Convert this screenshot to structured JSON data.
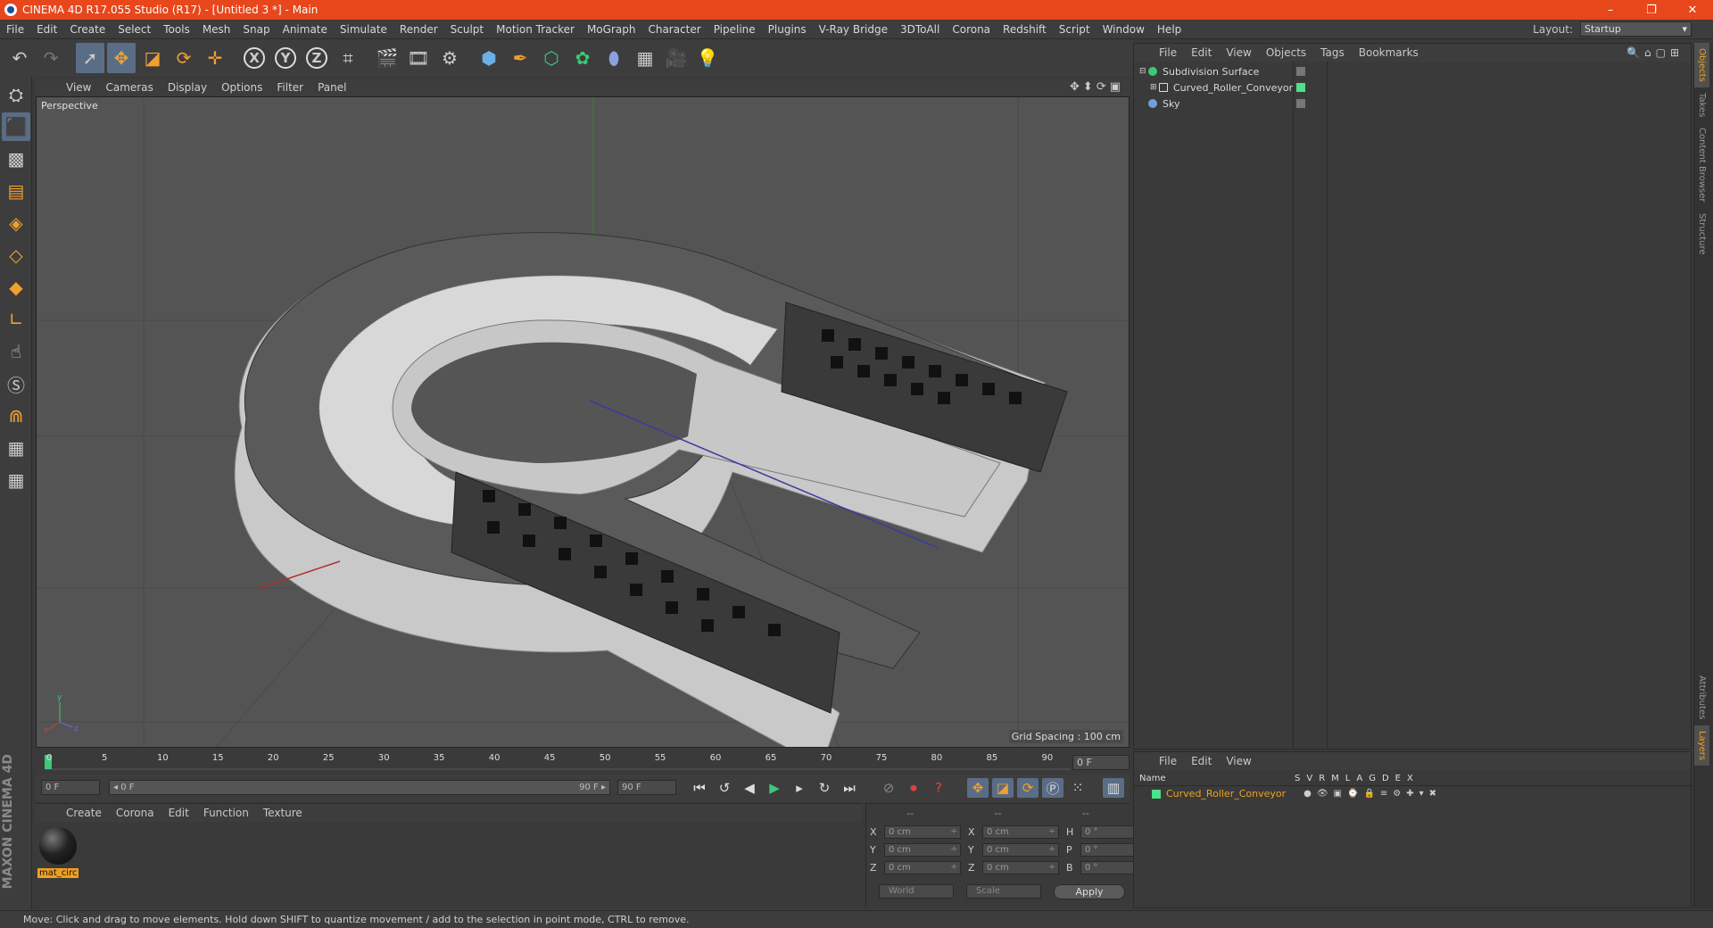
{
  "window": {
    "title": "CINEMA 4D R17.055 Studio (R17) - [Untitled 3 *] - Main",
    "min": "–",
    "max": "❐",
    "close": "✕"
  },
  "menu": [
    "File",
    "Edit",
    "Create",
    "Select",
    "Tools",
    "Mesh",
    "Snap",
    "Animate",
    "Simulate",
    "Render",
    "Sculpt",
    "Motion Tracker",
    "MoGraph",
    "Character",
    "Pipeline",
    "Plugins",
    "V-Ray Bridge",
    "3DToAll",
    "Corona",
    "Redshift",
    "Script",
    "Window",
    "Help"
  ],
  "layout": {
    "label": "Layout:",
    "value": "Startup"
  },
  "viewport": {
    "menu": [
      "View",
      "Cameras",
      "Display",
      "Options",
      "Filter",
      "Panel"
    ],
    "camera_label": "Perspective",
    "grid_spacing": "Grid Spacing : 100 cm"
  },
  "timeline": {
    "ticks": [
      "0",
      "5",
      "10",
      "15",
      "20",
      "25",
      "30",
      "35",
      "40",
      "45",
      "50",
      "55",
      "60",
      "65",
      "70",
      "75",
      "80",
      "85",
      "90"
    ],
    "current_frame": "0 F",
    "start_field": "0 F",
    "range_left": "◂ 0 F",
    "range_right": "90 F ▸",
    "end_field": "90 F"
  },
  "material_panel": {
    "menu": [
      "Create",
      "Corona",
      "Edit",
      "Function",
      "Texture"
    ],
    "material_name": "mat_circ"
  },
  "coords": {
    "headers": [
      "--",
      "--",
      "--"
    ],
    "rows": [
      {
        "a": "X",
        "av": "0 cm",
        "b": "X",
        "bv": "0 cm",
        "c": "H",
        "cv": "0 °"
      },
      {
        "a": "Y",
        "av": "0 cm",
        "b": "Y",
        "bv": "0 cm",
        "c": "P",
        "cv": "0 °"
      },
      {
        "a": "Z",
        "av": "0 cm",
        "b": "Z",
        "bv": "0 cm",
        "c": "B",
        "cv": "0 °"
      }
    ],
    "world": "World",
    "scale": "Scale",
    "apply": "Apply"
  },
  "status": "Move: Click and drag to move elements. Hold down SHIFT to quantize movement / add to the selection in point mode, CTRL to remove.",
  "objects": {
    "menu": [
      "File",
      "Edit",
      "View",
      "Objects",
      "Tags",
      "Bookmarks"
    ],
    "items": [
      {
        "name": "Subdivision Surface",
        "color": "#3cc878"
      },
      {
        "name": "Curved_Roller_Conveyor",
        "color": "#d0d0d0"
      },
      {
        "name": "Sky",
        "color": "#6ea0d8"
      }
    ]
  },
  "layers": {
    "menu": [
      "File",
      "Edit",
      "View"
    ],
    "header_name": "Name",
    "cols": [
      "S",
      "V",
      "R",
      "M",
      "L",
      "A",
      "G",
      "D",
      "E",
      "X"
    ],
    "row": "Curved_Roller_Conveyor"
  },
  "right_tabs": [
    "Objects",
    "Takes",
    "Content Browser",
    "Structure",
    "Attributes",
    "Layers"
  ],
  "brand": "MAXON CINEMA 4D",
  "colors": {
    "titlebar": "#e8461b",
    "accent_orange": "#f0a020",
    "active_blue": "#5a6d86"
  }
}
